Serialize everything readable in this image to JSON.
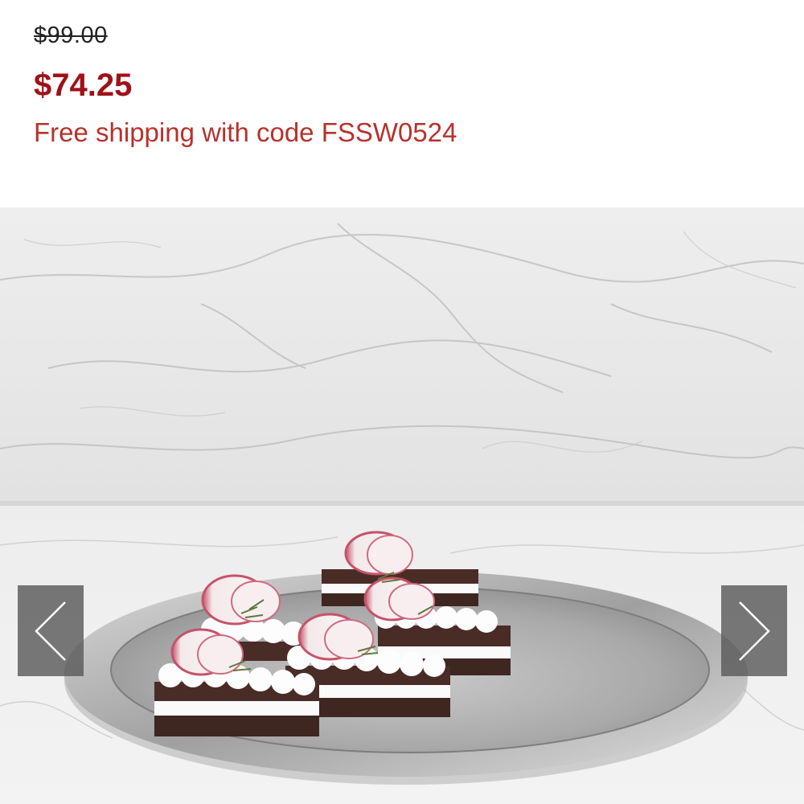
{
  "product": {
    "original_price": "$99.00",
    "sale_price": "$74.25",
    "shipping_note": "Free shipping with code FSSW0524"
  },
  "gallery": {
    "image_subject": "stainless steel serving tray with layered hors d'oeuvres on marble",
    "prev_icon": "chevron-left-icon",
    "next_icon": "chevron-right-icon"
  },
  "colors": {
    "sale_price": "#9f1118",
    "shipping_text": "#b7322d",
    "original_price": "#222222",
    "nav_button": "#5a5a5a"
  }
}
